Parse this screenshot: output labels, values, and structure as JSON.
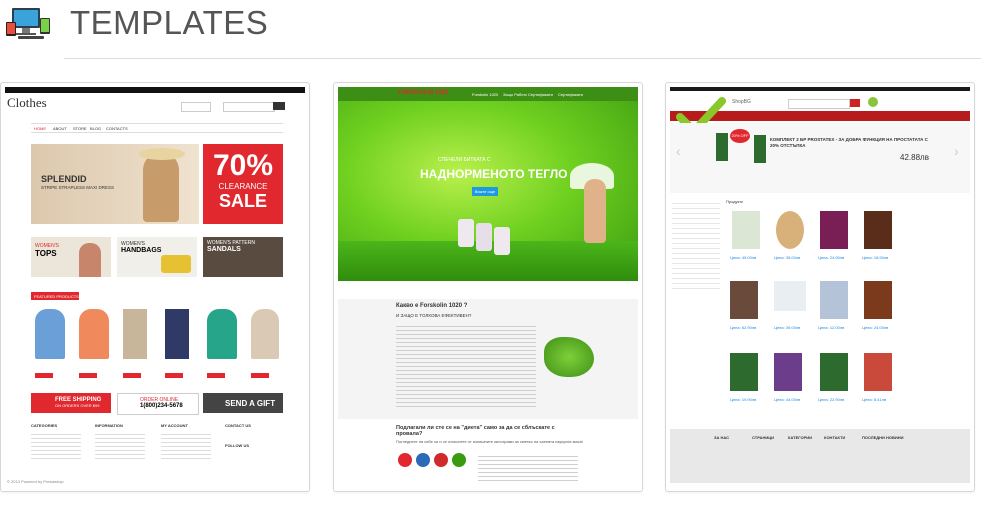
{
  "header": {
    "title": "TEMPLATES",
    "logo_icon": "computer-devices-logo-icon"
  },
  "card1": {
    "brand": "Clothes",
    "nav": [
      "HOME",
      "ABOUT",
      "STORE",
      "BLOG",
      "CONTACTS"
    ],
    "hero_line1": "SPLENDID",
    "hero_line2": "STRIPE STRAPLESS MAXI DRESS",
    "sale_big": "70%",
    "sale_mid": "CLEARANCE",
    "sale_word": "SALE",
    "promo1_a": "WOMEN'S",
    "promo1_b": "TOPS",
    "promo2_a": "WOMEN'S",
    "promo2_b": "HANDBAGS",
    "promo3_a": "WOMEN'S PATTERN",
    "promo3_b": "SANDALS",
    "featured": "FEATURED PRODUCTS",
    "ship_a": "FREE SHIPPING",
    "ship_b": "ON ORDERS OVER $99",
    "order_a": "ORDER ONLINE",
    "order_b": "1(800)234-5678",
    "gift": "SEND A GIFT",
    "foot_cols": [
      "CATEGORIES",
      "INFORMATION",
      "MY ACCOUNT",
      "CONTACT US"
    ],
    "follow": "FOLLOW US",
    "copyright": "© 2013 Powered by Prestashop"
  },
  "card2": {
    "brand": "FORSKOLIN 1020",
    "nav": [
      "Forskolin 1020",
      "Защо Работи",
      "Сертификати",
      "Сертификати"
    ],
    "hero_pre": "СПЕЧЕЛИ БИТКАТА С",
    "hero_main": "НАДНОРМЕНОТО ТЕГЛО",
    "hero_btn": "Вижте още",
    "q1": "Какво е Forskolin 1020 ?",
    "q1_sub": "И ЗАЩО Е ТОЛКОВА ЕФЕКТИВЕН?",
    "q2": "Подлагали ли сте се на \"диета\" само за да се сблъскате с провала?",
    "q2_sub": "Погледнете на себе си и се откъснете от излишните килограми за сметка на чаената изукусна маса!"
  },
  "card3": {
    "brand": "ShopBG",
    "banner_title": "КОМПЛЕКТ 2 БР PROSTATEX - ЗА ДОБРА ФУНКЦИЯ НА ПРОСТАТАТА С 20% ОТСТЪПКА",
    "banner_price": "42.88лв",
    "badge": "20% OFF",
    "section": "Продукти",
    "prices": [
      "Цена: 49.00лв",
      "Цена: 35.00лв",
      "Цена: 24.90лв",
      "Цена: 18.90лв",
      "Цена: 62.90лв",
      "Цена: 39.00лв",
      "Цена: 12.00лв",
      "Цена: 24.00лв",
      "Цена: 19.90лв",
      "Цена: 44.00лв",
      "Цена: 22.90лв",
      "Цена: 8.41лв"
    ],
    "footer_cols": [
      "ЗА НАС",
      "СТРАНИЦИ",
      "КАТЕГОРИИ",
      "КОНТАКТИ",
      "ПОСЛЕДНИ НОВИНИ"
    ]
  },
  "colors": {
    "accent_red": "#e0282e",
    "green": "#6cc41b"
  }
}
